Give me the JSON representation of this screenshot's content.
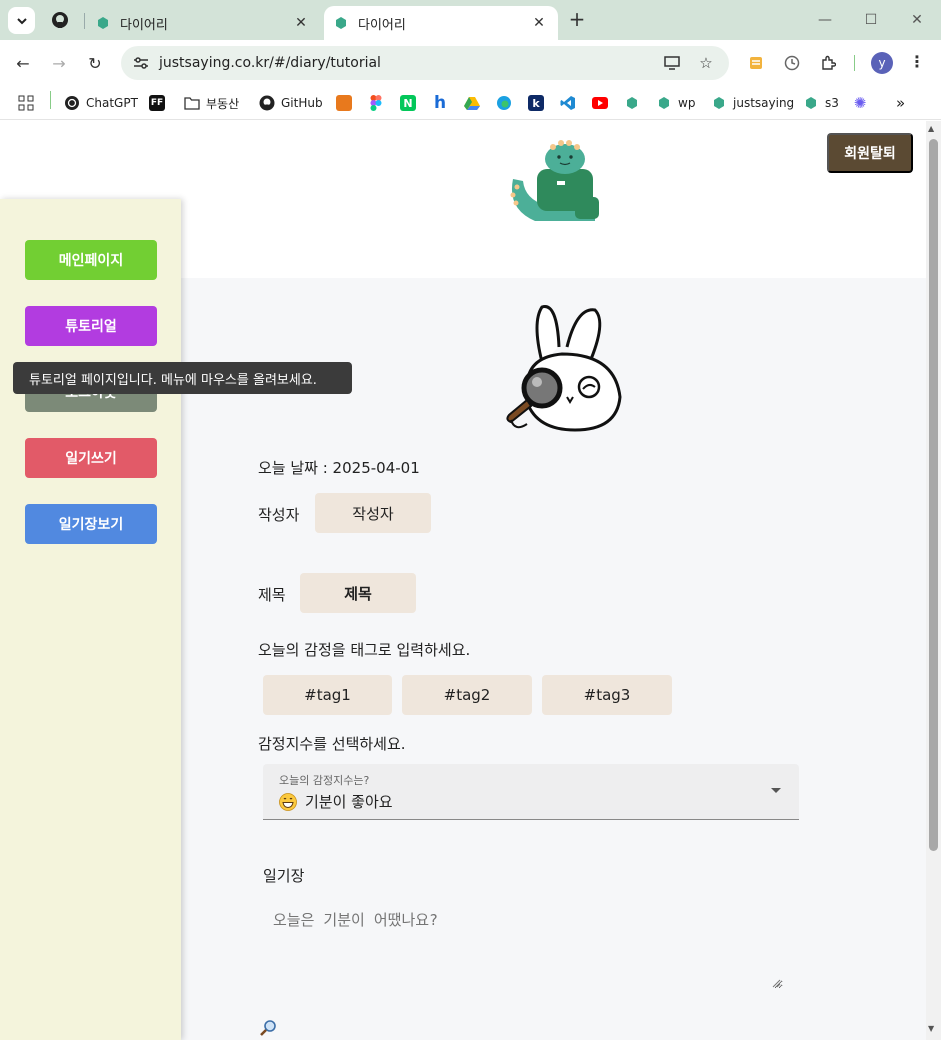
{
  "browser": {
    "tabs": [
      {
        "title": "다이어리",
        "active": false
      },
      {
        "title": "다이어리",
        "active": true
      }
    ],
    "url": "justsaying.co.kr/#/diary/tutorial",
    "profile_initial": "y",
    "bookmarks": [
      {
        "label": "ChatGPT",
        "icon": "chatgpt-icon"
      },
      {
        "label": "",
        "icon": "ff-icon"
      },
      {
        "label": "부동산",
        "icon": "folder-icon"
      },
      {
        "label": "GitHub",
        "icon": "github-icon"
      },
      {
        "label": "",
        "icon": "orange-icon"
      },
      {
        "label": "",
        "icon": "figma-icon"
      },
      {
        "label": "",
        "icon": "naver-icon"
      },
      {
        "label": "",
        "icon": "h-icon"
      },
      {
        "label": "",
        "icon": "drive-icon"
      },
      {
        "label": "",
        "icon": "edge-icon"
      },
      {
        "label": "",
        "icon": "k-icon"
      },
      {
        "label": "",
        "icon": "vscode-icon"
      },
      {
        "label": "",
        "icon": "youtube-icon"
      },
      {
        "label": "",
        "icon": "diary-icon"
      },
      {
        "label": "wp",
        "icon": "diary-icon"
      },
      {
        "label": "justsaying",
        "icon": "diary-icon"
      },
      {
        "label": "s3",
        "icon": "diary-icon"
      },
      {
        "label": "",
        "icon": "sparkle-icon"
      }
    ]
  },
  "header": {
    "withdraw_label": "회원탈퇴"
  },
  "sidebar": {
    "items": [
      {
        "label": "메인페이지"
      },
      {
        "label": "튜토리얼"
      },
      {
        "label": "로그아웃"
      },
      {
        "label": "일기쓰기"
      },
      {
        "label": "일기장보기"
      }
    ],
    "tooltip": "튜토리얼 페이지입니다. 메뉴에 마우스를 올려보세요."
  },
  "form": {
    "date_text": "오늘 날짜 : 2025-04-01",
    "author_label": "작성자",
    "author_button": "작성자",
    "title_label": "제목",
    "title_button": "제목",
    "tag_prompt": "오늘의 감정을 태그로 입력하세요.",
    "tags": [
      "#tag1",
      "#tag2",
      "#tag3"
    ],
    "score_prompt": "감정지수를 선택하세요.",
    "score_caption": "오늘의 감정지수는?",
    "score_value": "기분이 좋아요",
    "diary_label": "일기장",
    "diary_placeholder": "오늘은 기분이 어땠나요?"
  },
  "colors": {
    "sidebar_main": "#72cf33",
    "sidebar_tutorial": "#b23ce0",
    "sidebar_logout": "#7c8a78",
    "sidebar_write": "#e25a68",
    "sidebar_view": "#5189e0",
    "withdraw_bg": "#5b4a33",
    "field_bg": "#efe6dc"
  }
}
